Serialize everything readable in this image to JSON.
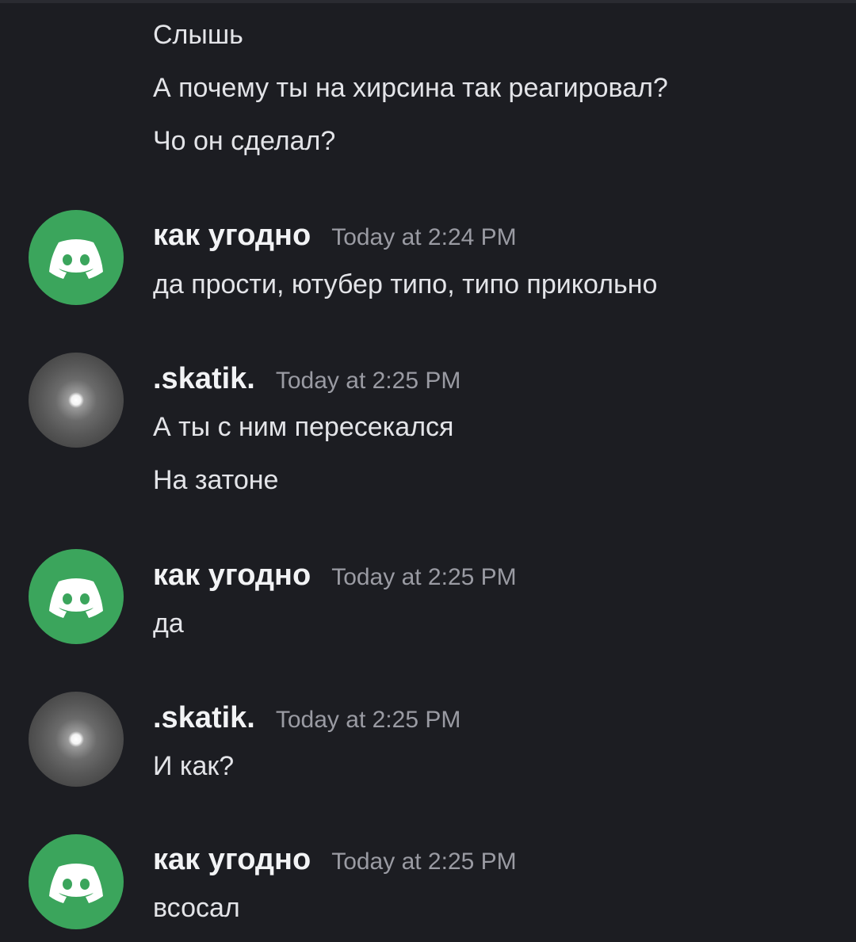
{
  "messages": {
    "top_lines": [
      "Слышь",
      "А почему ты на хирсина так реагировал?",
      "Чо он сделал?"
    ],
    "group1": {
      "username": "как угодно",
      "timestamp": "Today at 2:24 PM",
      "lines": [
        "да прости, ютубер типо, типо прикольно"
      ]
    },
    "group2": {
      "username": ".skatik.",
      "timestamp": "Today at 2:25 PM",
      "lines": [
        "А ты с ним пересекался",
        "На затоне"
      ]
    },
    "group3": {
      "username": "как угодно",
      "timestamp": "Today at 2:25 PM",
      "lines": [
        "да"
      ]
    },
    "group4": {
      "username": ".skatik.",
      "timestamp": "Today at 2:25 PM",
      "lines": [
        "И как?"
      ]
    },
    "group5": {
      "username": "как угодно",
      "timestamp": "Today at 2:25 PM",
      "lines": [
        "всосал"
      ]
    }
  },
  "icons": {
    "green_avatar": "discord-logo-icon",
    "moon_avatar": "moon-avatar"
  },
  "colors": {
    "background": "#1c1d22",
    "avatar_green": "#3ba55c",
    "text": "#e3e4e8",
    "timestamp": "#9a9ba3"
  }
}
